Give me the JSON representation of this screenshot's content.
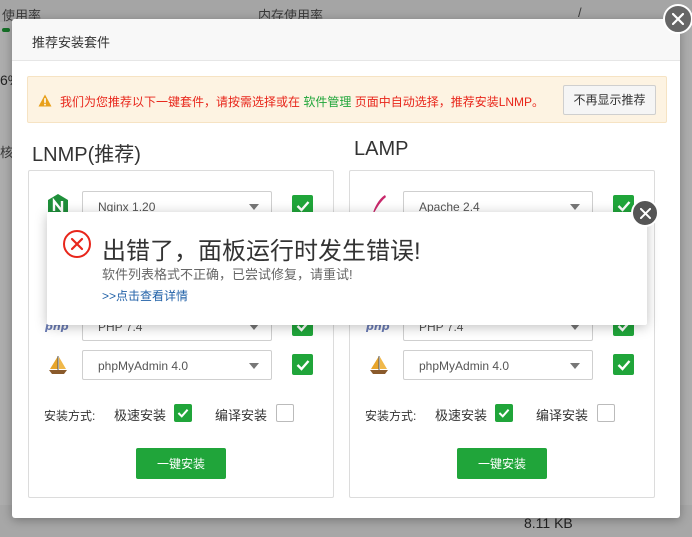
{
  "background": {
    "usage_label": "使用率",
    "memory_label": "内存使用率",
    "slash": "/",
    "percent_fragment": "6%",
    "side_fragment": "核",
    "size_value": "8.11 KB"
  },
  "modal": {
    "title": "推荐安装套件",
    "notice": {
      "text_before": "我们为您推荐以下一键套件，请按需选择或在 ",
      "link": "软件管理",
      "text_after": " 页面中自动选择，推荐安装LNMP。",
      "dismiss_button": "不再显示推荐"
    },
    "columns": [
      {
        "title": "LNMP(推荐)",
        "rows": [
          {
            "icon": "nginx-icon",
            "value": "Nginx 1.20"
          },
          {
            "icon": "php-icon",
            "value": "PHP 7.4"
          },
          {
            "icon": "phpmyadmin-icon",
            "value": "phpMyAdmin 4.0"
          }
        ],
        "method_label": "安装方式:",
        "fast_label": "极速安装",
        "compile_label": "编译安装",
        "install_button": "一键安装"
      },
      {
        "title": "LAMP",
        "rows": [
          {
            "icon": "apache-icon",
            "value": "Apache 2.4"
          },
          {
            "icon": "php-icon",
            "value": "PHP 7.4"
          },
          {
            "icon": "phpmyadmin-icon",
            "value": "phpMyAdmin 4.0"
          }
        ],
        "method_label": "安装方式:",
        "fast_label": "极速安装",
        "compile_label": "编译安装",
        "install_button": "一键安装"
      }
    ]
  },
  "error": {
    "title": "出错了，面板运行时发生错误!",
    "message": "软件列表格式不正确，已尝试修复，请重试!",
    "details_link": ">>点击查看详情"
  },
  "colors": {
    "accent_green": "#20a53a",
    "error_red": "#e8261b",
    "link_blue": "#2262a8",
    "notice_bg": "#fdf3e2"
  }
}
